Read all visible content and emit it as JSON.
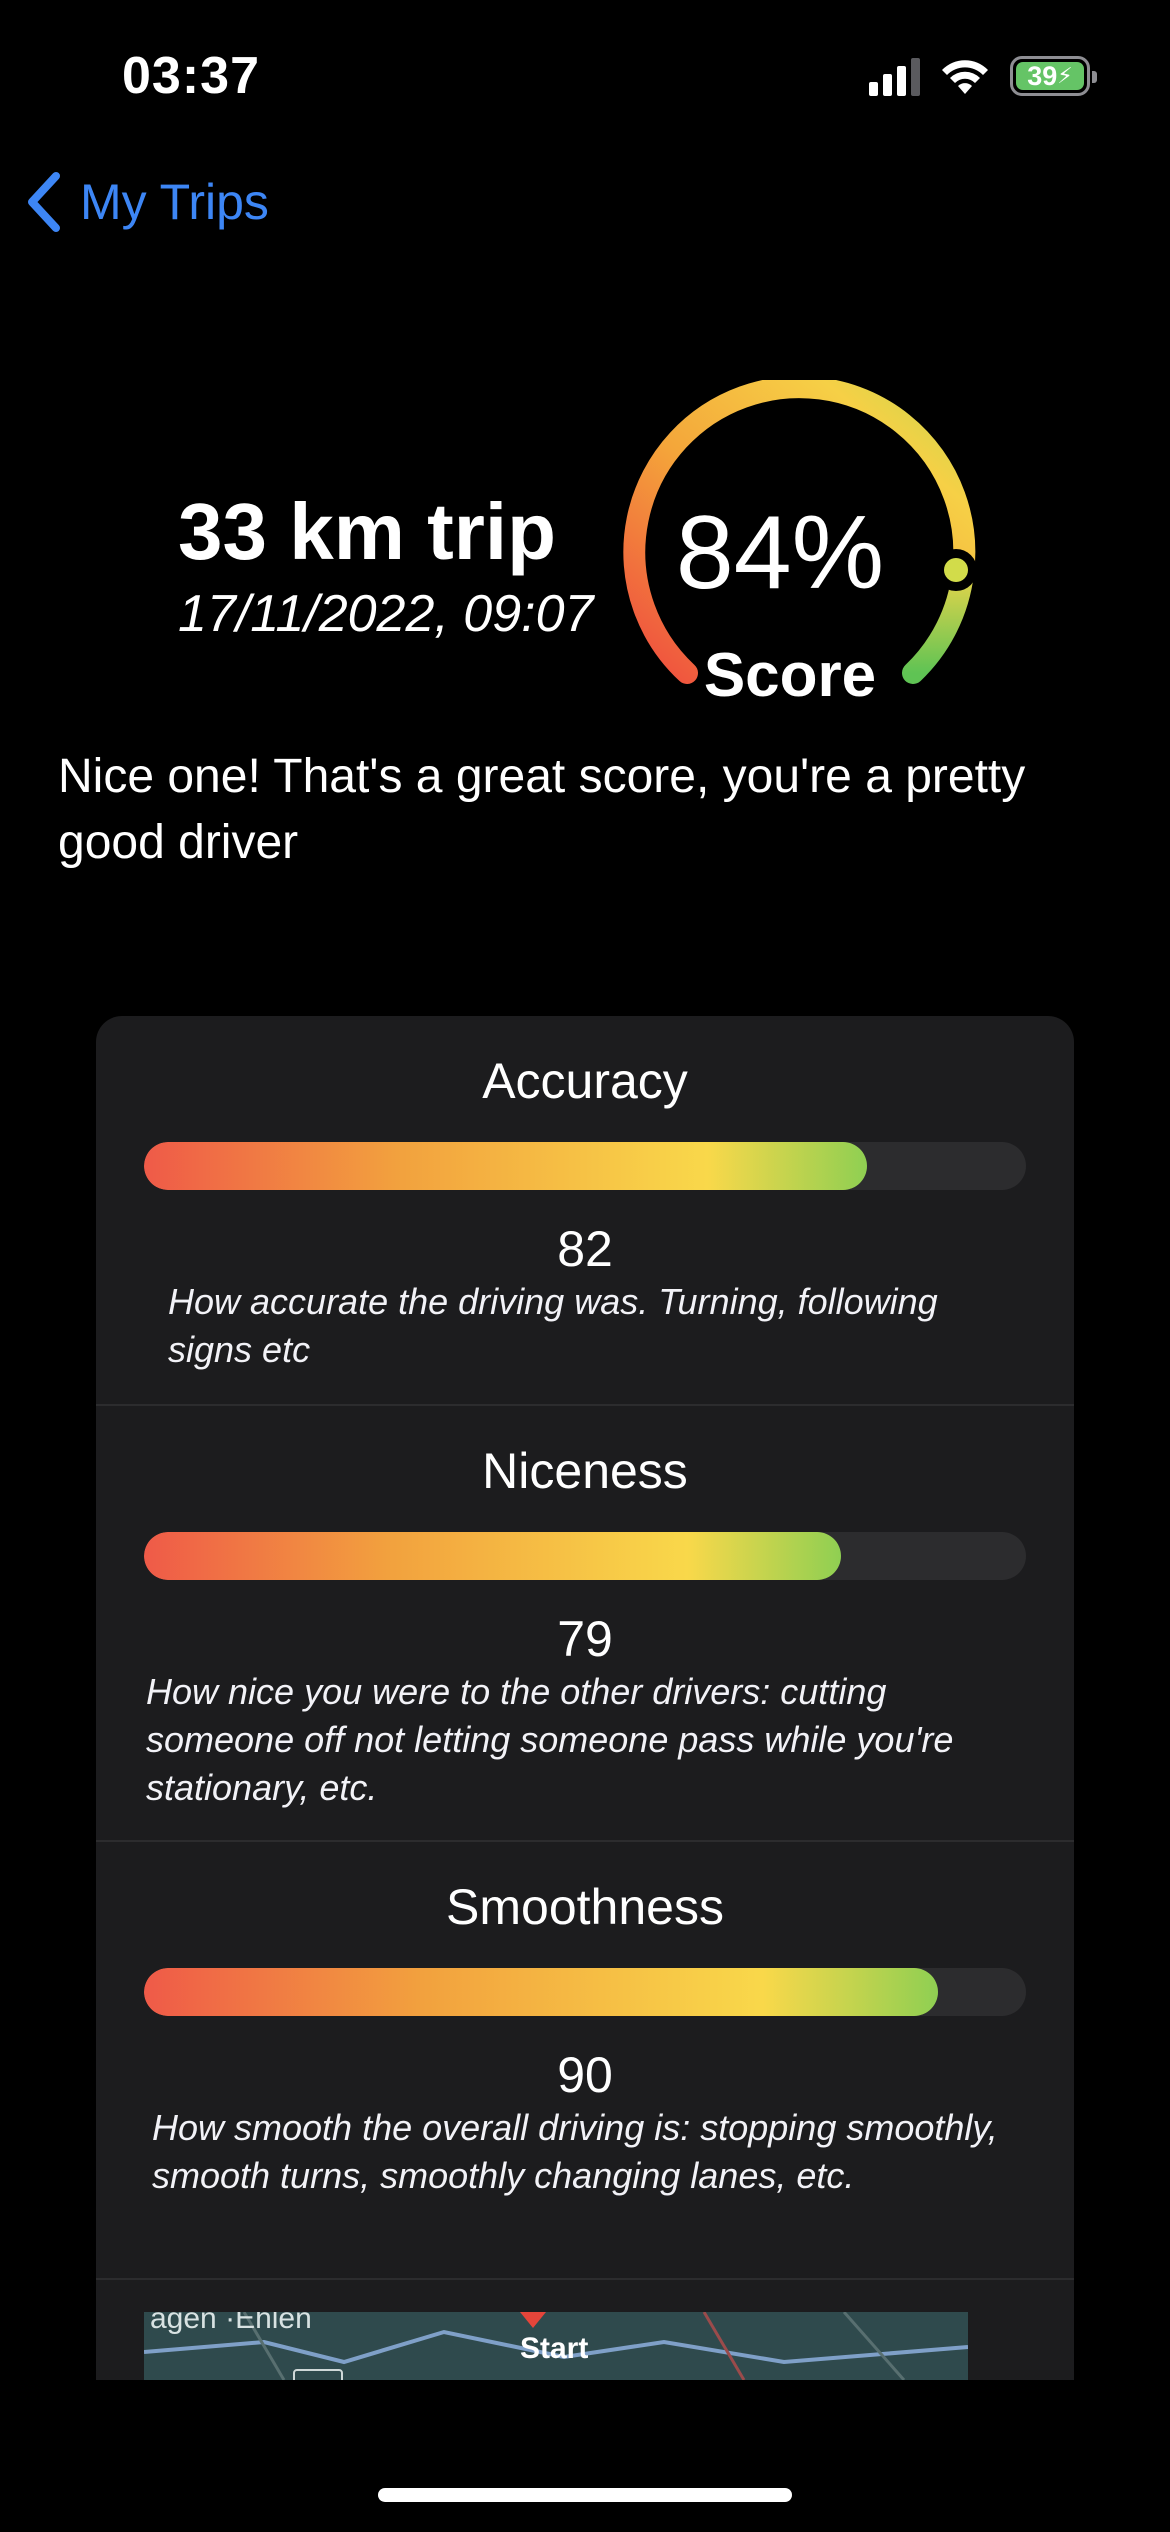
{
  "status_bar": {
    "time": "03:37",
    "battery": "39"
  },
  "nav": {
    "back_label": "My Trips"
  },
  "trip": {
    "title": "33 km trip",
    "date": "17/11/2022, 09:07"
  },
  "score": {
    "value": "84%",
    "label": "Score",
    "fraction": 0.84
  },
  "message": "Nice one! That's a great score, you're a pretty good driver",
  "metrics": [
    {
      "title": "Accuracy",
      "value": "82",
      "fraction": 0.82,
      "description": "How accurate the driving was. Turning, following signs etc"
    },
    {
      "title": "Niceness",
      "value": "79",
      "fraction": 0.79,
      "description": "How nice you were to the other drivers: cutting someone off not letting someone pass while you're stationary, etc."
    },
    {
      "title": "Smoothness",
      "value": "90",
      "fraction": 0.9,
      "description": "How smooth the overall driving is: stopping smoothly, smooth turns, smoothly changing lanes, etc."
    }
  ],
  "map": {
    "start_label": "Start",
    "place_label": "agen  ·Ehlen"
  },
  "colors": {
    "accent": "#3d86f5",
    "bar_start": "#ef5a48",
    "bar_mid": "#f9d84a",
    "bar_end": "#8fcf52",
    "card": "#1c1c1e"
  }
}
